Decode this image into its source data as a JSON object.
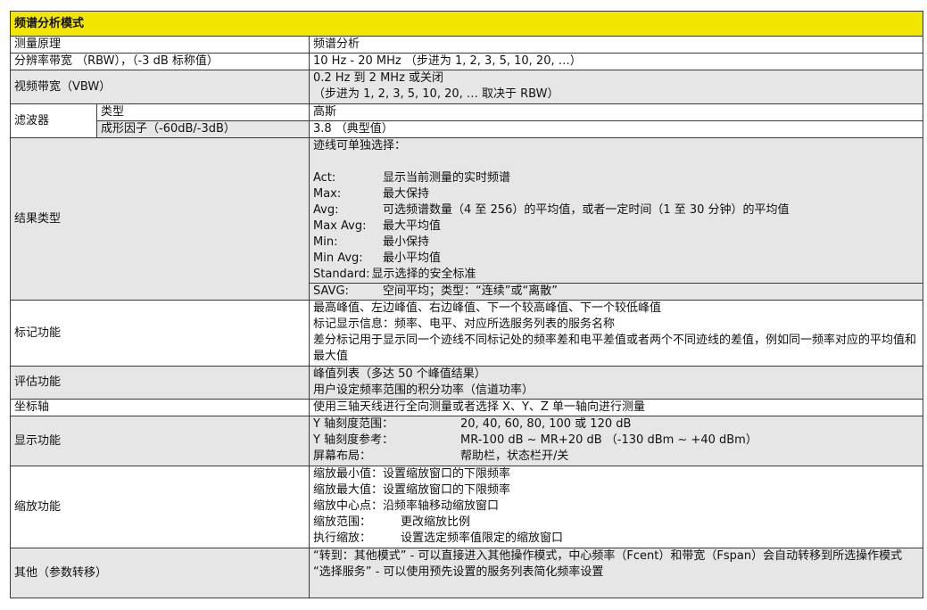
{
  "title": "频谱分析模式",
  "rows": {
    "principle": {
      "label": "测量原理",
      "value": "频谱分析"
    },
    "rbw": {
      "label": "分辨率带宽 （RBW），（-3 dB 标称值）",
      "value": "10 Hz - 20 MHz （步进为 1, 2, 3, 5, 10, 20, …）"
    },
    "vbw": {
      "label": "视频带宽（VBW）",
      "lines": [
        "0.2 Hz 到 2 MHz 或关闭",
        "（步进为 1, 2, 3, 5, 10, 20, … 取决于 RBW）"
      ]
    },
    "filter": {
      "label": "滤波器",
      "type": {
        "label": "类型",
        "value": "高斯"
      },
      "shape": {
        "label": "成形因子（-60dB/-3dB）",
        "value": "3.8 （典型值）"
      }
    },
    "result": {
      "label": "结果类型",
      "intro": "迹线可单独选择：",
      "items": [
        {
          "k": "Act:",
          "v": "显示当前测量的实时频谱"
        },
        {
          "k": "Max:",
          "v": "最大保持"
        },
        {
          "k": "Avg:",
          "v": "可选频谱数量（4 至 256）的平均值，或者一定时间（1 至 30 分钟）的平均值"
        },
        {
          "k": "Max Avg:",
          "v": "最大平均值"
        },
        {
          "k": "Min:",
          "v": "最小保持"
        },
        {
          "k": "Min Avg:",
          "v": "最小平均值"
        },
        {
          "k": "Standard:",
          "v": "显示选择的安全标准"
        }
      ],
      "savg": {
        "k": "SAVG:",
        "v": "空间平均；类型：“连续”或“离散”"
      }
    },
    "marker": {
      "label": "标记功能",
      "lines": [
        "最高峰值、左边峰值、右边峰值、下一个较高峰值、下一个较低峰值",
        "标记显示信息：频率、电平、对应所选服务列表的服务名称",
        "差分标记用于显示同一个迹线不同标记处的频率差和电平差值或者两个不同迹线的差值，例如同一频率对应的平均值和最大值"
      ]
    },
    "eval": {
      "label": "评估功能",
      "lines": [
        "峰值列表（多达 50 个峰值结果）",
        "用户设定频率范围的积分功率（信道功率）"
      ]
    },
    "axis": {
      "label": "坐标轴",
      "value": "使用三轴天线进行全向测量或者选择 X、Y、Z 单一轴向进行测量"
    },
    "display": {
      "label": "显示功能",
      "items": [
        {
          "k": "Y 轴刻度范围：",
          "v": "20, 40, 60, 80, 100 或 120 dB"
        },
        {
          "k": "Y 轴刻度参考：",
          "v": "MR-100 dB ~ MR+20 dB （-130 dBm ~ +40 dBm）"
        },
        {
          "k": "屏幕布局：",
          "v": "帮助栏，状态栏开/关"
        }
      ]
    },
    "zoom": {
      "label": "缩放功能",
      "lines": [
        "缩放最小值：设置缩放窗口的下限频率",
        "缩放最大值：设置缩放窗口的下限频率",
        "缩放中心点：沿频率轴移动缩放窗口"
      ],
      "items": [
        {
          "k": "缩放范围：",
          "v": "更改缩放比例"
        },
        {
          "k": "执行缩放：",
          "v": "设置选定频率值限定的缩放窗口"
        }
      ]
    },
    "other": {
      "label": "其他（参数转移）",
      "lines": [
        "“转到：其他模式” - 可以直接进入其他操作模式，中心频率（Fcent）和带宽（Fspan）会自动转移到所选操作模式",
        "“选择服务” - 可以使用预先设置的服务列表简化频率设置"
      ]
    }
  }
}
